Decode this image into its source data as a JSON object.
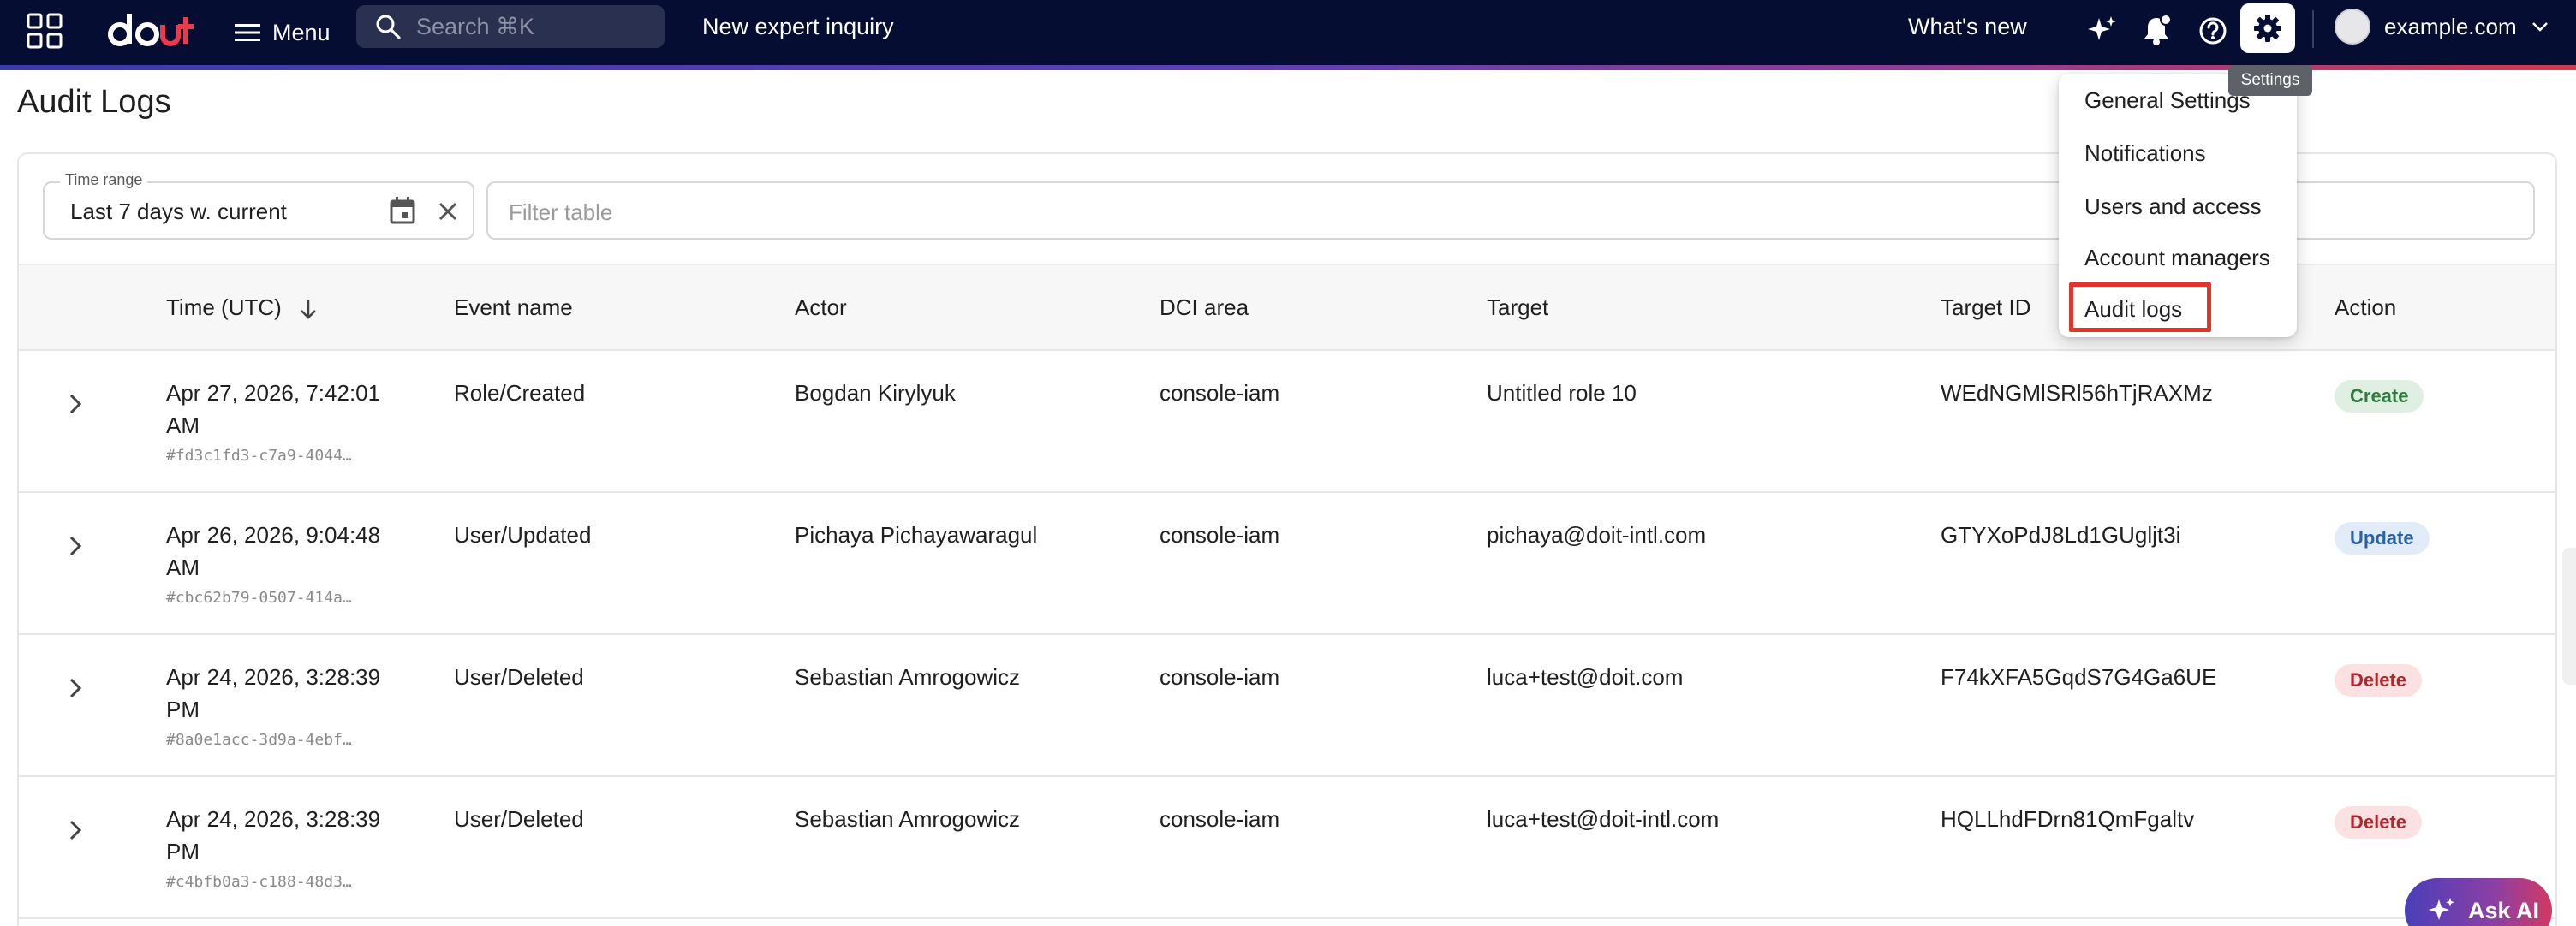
{
  "topbar": {
    "menu_label": "Menu",
    "search_placeholder": "Search ⌘K",
    "expert_inquiry": "New expert inquiry",
    "whats_new": "What's new",
    "account_name": "example.com",
    "settings_tooltip": "Settings"
  },
  "page": {
    "title": "Audit Logs"
  },
  "filters": {
    "time_range_label": "Time range",
    "time_range_value": "Last 7 days w. current",
    "filter_placeholder": "Filter table"
  },
  "table": {
    "columns": [
      "Time (UTC)",
      "Event name",
      "Actor",
      "DCI area",
      "Target",
      "Target ID",
      "Action"
    ],
    "rows": [
      {
        "time_line1": "Apr 27, 2026, 7:42:01",
        "time_line2": "AM",
        "hash": "#fd3c1fd3-c7a9-4044…",
        "event": "Role/Created",
        "actor": "Bogdan Kirylyuk",
        "dci": "console-iam",
        "target": "Untitled role 10",
        "target_id": "WEdNGMlSRl56hTjRAXMz",
        "action": "Create",
        "action_kind": "create"
      },
      {
        "time_line1": "Apr 26, 2026, 9:04:48",
        "time_line2": "AM",
        "hash": "#cbc62b79-0507-414a…",
        "event": "User/Updated",
        "actor": "Pichaya Pichayawaragul",
        "dci": "console-iam",
        "target": "pichaya@doit-intl.com",
        "target_id": "GTYXoPdJ8Ld1GUgljt3i",
        "action": "Update",
        "action_kind": "update"
      },
      {
        "time_line1": "Apr 24, 2026, 3:28:39",
        "time_line2": "PM",
        "hash": "#8a0e1acc-3d9a-4ebf…",
        "event": "User/Deleted",
        "actor": "Sebastian Amrogowicz",
        "dci": "console-iam",
        "target": "luca+test@doit.com",
        "target_id": "F74kXFA5GqdS7G4Ga6UE",
        "action": "Delete",
        "action_kind": "delete"
      },
      {
        "time_line1": "Apr 24, 2026, 3:28:39",
        "time_line2": "PM",
        "hash": "#c4bfb0a3-c188-48d3…",
        "event": "User/Deleted",
        "actor": "Sebastian Amrogowicz",
        "dci": "console-iam",
        "target": "luca+test@doit-intl.com",
        "target_id": "HQLLhdFDrn81QmFgaltv",
        "action": "Delete",
        "action_kind": "delete"
      }
    ]
  },
  "settings_menu": {
    "items": [
      "General Settings",
      "Notifications",
      "Users and access",
      "Account managers",
      "Audit logs"
    ],
    "highlighted": "Audit logs"
  },
  "ask_ai": {
    "label": "Ask AI"
  },
  "colors": {
    "topbar_bg": "#050d33",
    "brand_red": "#ea3a4b",
    "highlight_red": "#e0352b",
    "create_badge": "#dff0e2",
    "update_badge": "#e2ecf8",
    "delete_badge": "#fbe1e1"
  },
  "icons": [
    "apps-grid-icon",
    "menu-icon",
    "search-icon",
    "sparkle-icon",
    "bell-icon",
    "help-icon",
    "gear-icon",
    "chevron-down-icon",
    "calendar-icon",
    "close-icon",
    "sort-down-icon",
    "chevron-right-icon"
  ]
}
